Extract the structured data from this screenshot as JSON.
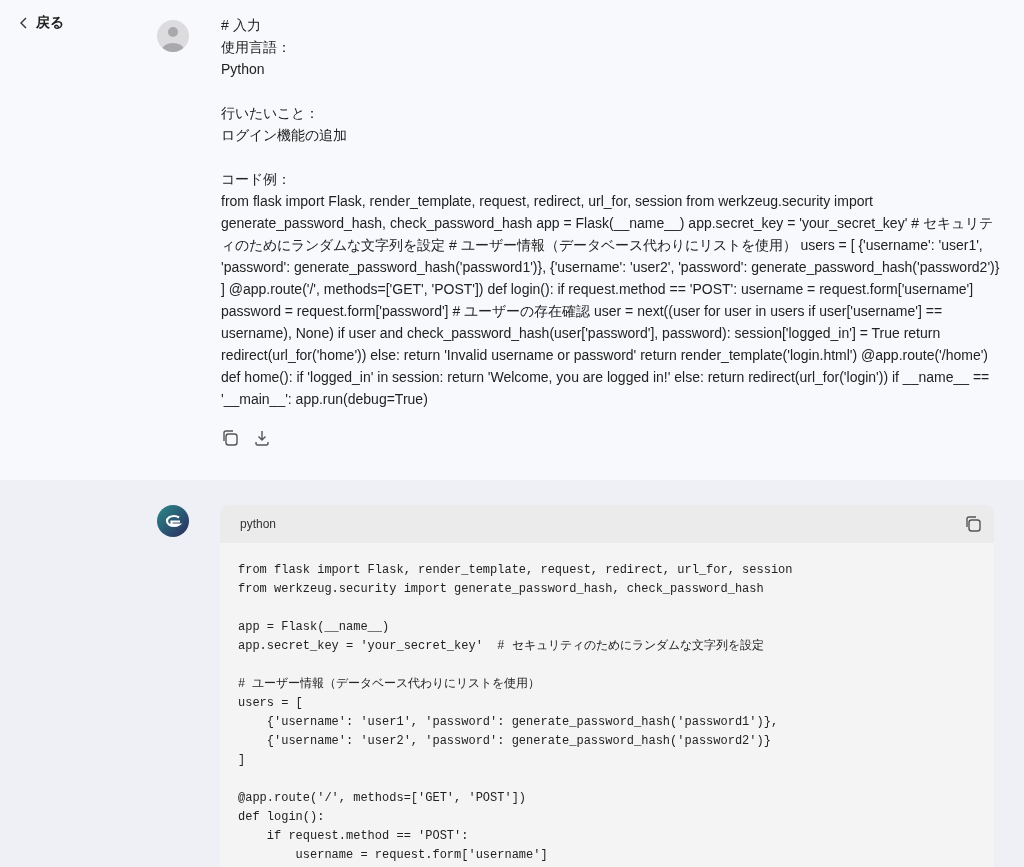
{
  "back": {
    "label": "戻る"
  },
  "user_message": {
    "paragraphs": [
      [
        "# 入力",
        "使用言語：",
        "Python"
      ],
      [
        "行いたいこと：",
        "ログイン機能の追加"
      ],
      [
        "コード例：",
        "from flask import Flask, render_template, request, redirect, url_for, session from werkzeug.security import generate_password_hash, check_password_hash app = Flask(__name__) app.secret_key = 'your_secret_key' # セキュリティのためにランダムな文字列を設定 # ユーザー情報（データベース代わりにリストを使用） users = [ {'username': 'user1', 'password': generate_password_hash('password1')}, {'username': 'user2', 'password': generate_password_hash('password2')} ] @app.route('/', methods=['GET', 'POST']) def login(): if request.method == 'POST': username = request.form['username'] password = request.form['password'] # ユーザーの存在確認 user = next((user for user in users if user['username'] == username), None) if user and check_password_hash(user['password'], password): session['logged_in'] = True return redirect(url_for('home')) else: return 'Invalid username or password' return render_template('login.html') @app.route('/home') def home(): if 'logged_in' in session: return 'Welcome, you are logged in!' else: return redirect(url_for('login')) if __name__ == '__main__': app.run(debug=True)"
      ]
    ]
  },
  "assistant_message": {
    "code_block": {
      "language": "python",
      "blocks": [
        [
          "from flask import Flask, render_template, request, redirect, url_for, session",
          "from werkzeug.security import generate_password_hash, check_password_hash"
        ],
        [
          "app = Flask(__name__)",
          "app.secret_key = 'your_secret_key'  # セキュリティのためにランダムな文字列を設定"
        ],
        [
          "# ユーザー情報（データベース代わりにリストを使用）",
          "users = [",
          "    {'username': 'user1', 'password': generate_password_hash('password1')},",
          "    {'username': 'user2', 'password': generate_password_hash('password2')}",
          "]"
        ],
        [
          "@app.route('/', methods=['GET', 'POST'])",
          "def login():",
          "    if request.method == 'POST':",
          "        username = request.form['username']"
        ]
      ]
    }
  }
}
